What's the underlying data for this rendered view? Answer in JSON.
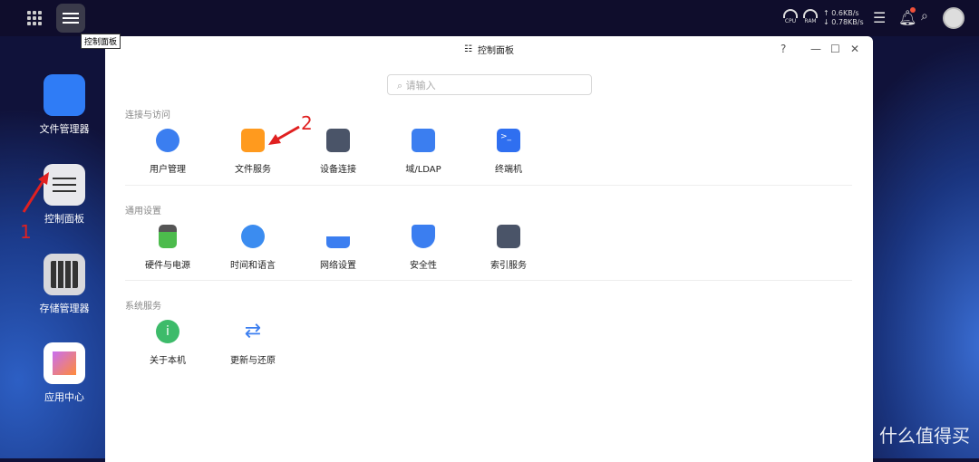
{
  "topbar": {
    "tooltip": "控制面板",
    "cpu": "CPU",
    "ram": "RAM",
    "up": "↑ 0.6KB/s",
    "down": "↓ 0.78KB/s"
  },
  "dock": [
    {
      "label": "文件管理器",
      "color": "#2f7cf6"
    },
    {
      "label": "控制面板",
      "color": "#e8e8ec"
    },
    {
      "label": "存储管理器",
      "color": "#d8d8dc"
    },
    {
      "label": "应用中心",
      "color": "#ffffff"
    }
  ],
  "window": {
    "title": "控制面板",
    "help": "?",
    "search_placeholder": "请输入",
    "sections": [
      {
        "title": "连接与访问",
        "items": [
          {
            "label": "用户管理",
            "color": "#3b7ef0"
          },
          {
            "label": "文件服务",
            "color": "#ff9a1e"
          },
          {
            "label": "设备连接",
            "color": "#4a5468"
          },
          {
            "label": "域/LDAP",
            "color": "#3b7ef0"
          },
          {
            "label": "终端机",
            "color": "#2f6ff0"
          }
        ]
      },
      {
        "title": "通用设置",
        "items": [
          {
            "label": "硬件与电源",
            "color": "#4cbb4c"
          },
          {
            "label": "时间和语言",
            "color": "#3b8cf0"
          },
          {
            "label": "网络设置",
            "color": "#3b7ef0"
          },
          {
            "label": "安全性",
            "color": "#3b7ef0"
          },
          {
            "label": "索引服务",
            "color": "#4a5468"
          }
        ]
      },
      {
        "title": "系统服务",
        "items": [
          {
            "label": "关于本机",
            "color": "#3dbb6a"
          },
          {
            "label": "更新与还原",
            "color": "#3b7ef0"
          }
        ]
      }
    ]
  },
  "annotations": {
    "one": "1",
    "two": "2"
  },
  "watermark": "值 什么值得买"
}
